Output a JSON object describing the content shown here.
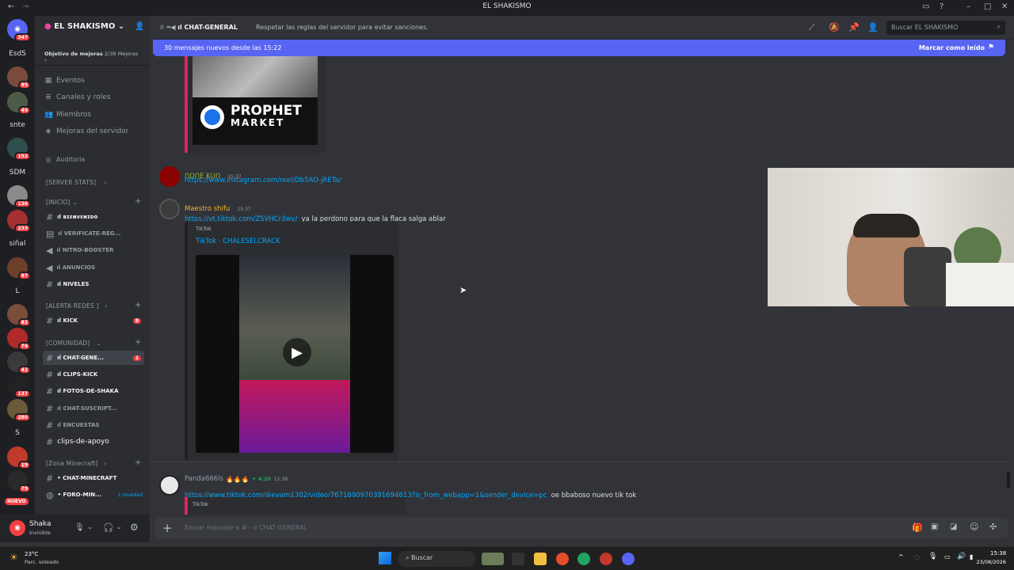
{
  "window": {
    "title": "EL SHAKISMO"
  },
  "rail": {
    "servers": [
      {
        "label": "",
        "badge": "347"
      },
      {
        "label": "EsdS",
        "badge": ""
      },
      {
        "label": "",
        "badge": "95"
      },
      {
        "label": "",
        "badge": "40"
      },
      {
        "label": "snte",
        "badge": ""
      },
      {
        "label": "",
        "badge": "152"
      },
      {
        "label": "SDM",
        "badge": ""
      },
      {
        "label": "",
        "badge": "136"
      },
      {
        "label": "",
        "badge": "233"
      },
      {
        "label": "siñal",
        "badge": ""
      },
      {
        "label": "",
        "badge": "97"
      },
      {
        "label": "L",
        "badge": ""
      },
      {
        "label": "",
        "badge": "82"
      },
      {
        "label": "",
        "badge": "76"
      },
      {
        "label": "",
        "badge": "42"
      },
      {
        "label": "",
        "badge": "137"
      },
      {
        "label": "",
        "badge": "280"
      },
      {
        "label": "S",
        "badge": ""
      },
      {
        "label": "",
        "badge": "19"
      },
      {
        "label": "",
        "badge": "79"
      }
    ],
    "new_label": "NUEVO"
  },
  "sidebar": {
    "server_name": "EL SHAKISMO",
    "boost_goal": "Objetivo de mejoras",
    "boost_count": "2/36 Mejoras",
    "items": [
      {
        "label": "Eventos",
        "icon": "calendar-icon"
      },
      {
        "label": "Canales y roles",
        "icon": "list-icon"
      },
      {
        "label": "Miembros",
        "icon": "members-icon"
      },
      {
        "label": "Mejoras del servidor",
        "icon": "boost-icon"
      },
      {
        "label": "Auditoria",
        "icon": "audit-icon"
      }
    ],
    "categories": {
      "stats": "[SERVER STATS]",
      "inicio": "[INICIO]",
      "alerta": "[ALERTA REDES ]",
      "comunidad": "[COMUNIDAD]",
      "minecraft": "[Zona Minecraft]"
    },
    "channels": {
      "bienvenido": "ıl ʙɪᴇɴᴠᴇɴɪᴅᴏ",
      "verificate": "ıl VERIFICATE-REG...",
      "nitro": "ıl NITRO-BOOSTER",
      "anuncios": "ıl ANUNCIOS",
      "niveles": "ıl NIVELES",
      "kick": "ıl KICK",
      "kick_badge": "8",
      "chat_general": "ıl CHAT-GENE...",
      "chat_general_badge": "1",
      "clips_kick": "ıl CLIPS-KICK",
      "fotos": "ıl FOTOS-DE-SHAKA",
      "chat_suscript": "ıl CHAT-SUSCRIPT...",
      "encuestas": "ıl ENCUESTAS",
      "clips_apoyo": "clips-de-apoyo",
      "chat_minecraft": "• CHAT-MINECRAFT",
      "foro_min": "• FORO-MIN...",
      "foro_novedad": "1 novedad"
    }
  },
  "user": {
    "name": "Shaka",
    "status": "Invisible"
  },
  "topbar": {
    "channel": "ıl CHAT-GENERAL",
    "topic": "Respetar las reglas del servidor para evitar sanciones.",
    "search_placeholder": "Buscar EL SHAKISMO"
  },
  "banner": {
    "text": "30 mensajes nuevos desde las 15:22",
    "action": "Marcar como leído"
  },
  "messages": {
    "prophet_logo_line1": "PROPHET",
    "prophet_logo_line2": "MARKET",
    "m1": {
      "author": "ᑎOᑎE Kᑌᑎ",
      "time": "15:37",
      "link": "https://www.instagram.com/reel/Db5AO-jRETa/"
    },
    "m2": {
      "author": "Maestro shifu",
      "time": "15:37",
      "link": "https://vt.tiktok.com/ZSVHCr3wy/",
      "text": "ya la perdono para que la flaca salga ablar",
      "embed_provider": "TikTok",
      "embed_title": "TikTok · CHALESELCRACK"
    },
    "m3": {
      "author": "Panda666ls",
      "level": "4:20",
      "time": "15:38",
      "link": "https://www.tiktok.com/@evam1302/video/7671690970391694613?is_from_webapp=1&sender_device=pc",
      "text": "oe bbaboso nuevo tik tok",
      "embed_provider": "TikTok"
    }
  },
  "composer": {
    "placeholder": "Enviar mensaje a #-- ıl CHAT-GENERAL"
  },
  "taskbar": {
    "temp": "23°C",
    "weather": "Parc. soleado",
    "search": "Buscar",
    "time": "15:38",
    "date": "23/08/2026"
  }
}
